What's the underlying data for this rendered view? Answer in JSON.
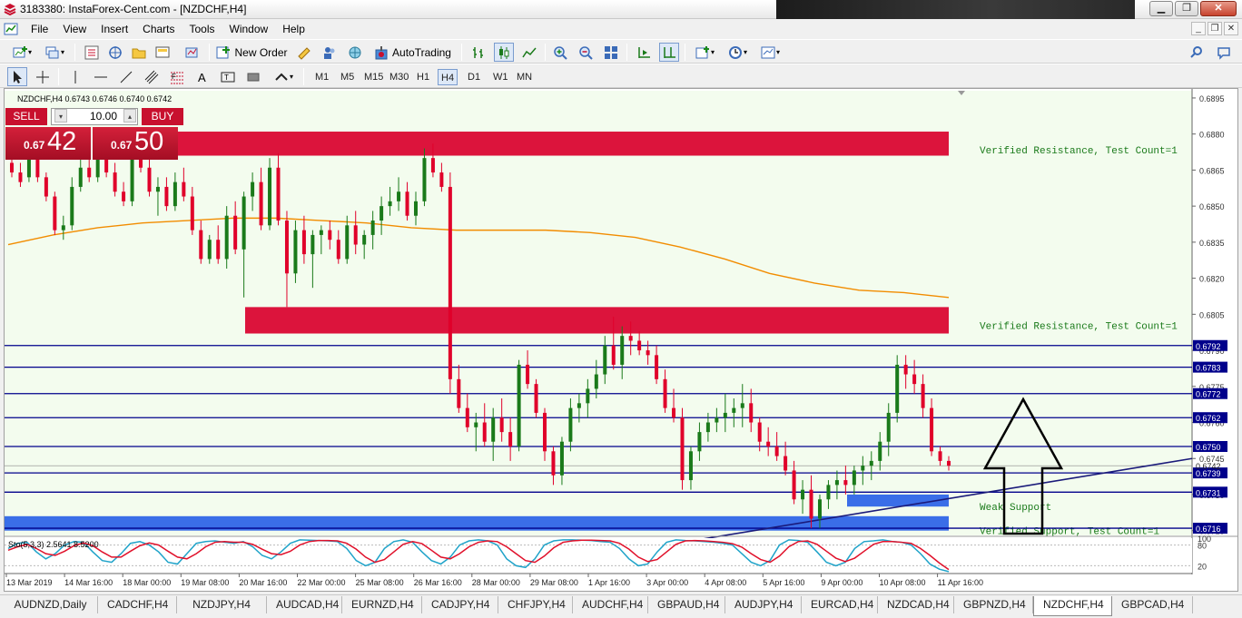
{
  "window": {
    "title": "3183380: InstaForex-Cent.com - [NZDCHF,H4]",
    "min": "▁",
    "max": "❐",
    "close": "✕"
  },
  "menu": [
    "File",
    "View",
    "Insert",
    "Charts",
    "Tools",
    "Window",
    "Help"
  ],
  "mdi": [
    "_",
    "❐",
    "✕"
  ],
  "toolbar": {
    "new_order": "New Order",
    "autotrading": "AutoTrading"
  },
  "timeframes": [
    "M1",
    "M5",
    "M15",
    "M30",
    "H1",
    "H4",
    "D1",
    "W1",
    "MN"
  ],
  "active_timeframe": "H4",
  "trade_panel": {
    "sell_label": "SELL",
    "buy_label": "BUY",
    "lot": "10.00",
    "sell_small": "0.67",
    "sell_big": "42",
    "buy_small": "0.67",
    "buy_big": "50"
  },
  "colors": {
    "bull": "#1a7a1a",
    "bear": "#e0002a",
    "ma": "#f28c00",
    "zone_red": "#dc143c",
    "zone_blue": "#3a6ee8",
    "line_blue": "#00008b",
    "stoch_main": "#1fa3c9",
    "stoch_signal": "#e0102a"
  },
  "chart_data": {
    "type": "candlestick",
    "header": "NZDCHF,H4  0.6743 0.6746 0.6740 0.6742",
    "ylim": [
      0.6713,
      0.6898
    ],
    "y_ticks": [
      "0.6895",
      "0.6880",
      "0.6865",
      "0.6850",
      "0.6835",
      "0.6820",
      "0.6805",
      "0.6790",
      "0.6775",
      "0.6760",
      "0.6745",
      "0.6730",
      "0.6715"
    ],
    "x_ticks": [
      "13 Mar 2019",
      "14 Mar 16:00",
      "18 Mar 00:00",
      "19 Mar 08:00",
      "20 Mar 16:00",
      "22 Mar 00:00",
      "25 Mar 08:00",
      "26 Mar 16:00",
      "28 Mar 00:00",
      "29 Mar 08:00",
      "1 Apr 16:00",
      "3 Apr 00:00",
      "4 Apr 08:00",
      "5 Apr 16:00",
      "9 Apr 00:00",
      "10 Apr 08:00",
      "11 Apr 16:00"
    ],
    "horizontal_levels": [
      {
        "value": 0.6792,
        "label": "0.6792"
      },
      {
        "value": 0.6783,
        "label": "0.6783"
      },
      {
        "value": 0.6772,
        "label": "0.6772"
      },
      {
        "value": 0.6762,
        "label": "0.6762"
      },
      {
        "value": 0.675,
        "label": "0.6750"
      },
      {
        "value": 0.6739,
        "label": "0.6739"
      },
      {
        "value": 0.6731,
        "label": "0.6731"
      },
      {
        "value": 0.6716,
        "label": "0.6716"
      }
    ],
    "current_price": {
      "value": 0.6742,
      "label": "0.6742"
    },
    "zones": [
      {
        "kind": "resistance",
        "y_top": 0.6881,
        "y_bottom": 0.6871,
        "label": "Verified Resistance, Test Count=1"
      },
      {
        "kind": "resistance",
        "y_top": 0.6808,
        "y_bottom": 0.6797,
        "label": "Verified Resistance, Test Count=1"
      },
      {
        "kind": "support",
        "y_top": 0.673,
        "y_bottom": 0.6725,
        "label": "Weak Support"
      },
      {
        "kind": "support",
        "y_top": 0.6721,
        "y_bottom": 0.6715,
        "label": "Verified Support, Test Count=1"
      }
    ],
    "ma_series": [
      0.6834,
      0.6838,
      0.6841,
      0.6843,
      0.6844,
      0.6845,
      0.6845,
      0.6844,
      0.6843,
      0.6841,
      0.684,
      0.684,
      0.684,
      0.6839,
      0.6837,
      0.6833,
      0.6828,
      0.6822,
      0.6818,
      0.6815,
      0.6814,
      0.6812
    ],
    "candles": [
      [
        0.6868,
        0.6872,
        0.6862,
        0.6864
      ],
      [
        0.6864,
        0.6868,
        0.6858,
        0.686
      ],
      [
        0.6862,
        0.6876,
        0.686,
        0.6872
      ],
      [
        0.6872,
        0.6875,
        0.686,
        0.6862
      ],
      [
        0.6862,
        0.6864,
        0.6852,
        0.6854
      ],
      [
        0.6854,
        0.6856,
        0.6838,
        0.684
      ],
      [
        0.684,
        0.6846,
        0.6836,
        0.6842
      ],
      [
        0.6842,
        0.6862,
        0.684,
        0.6858
      ],
      [
        0.6858,
        0.687,
        0.6856,
        0.6866
      ],
      [
        0.6866,
        0.687,
        0.686,
        0.6862
      ],
      [
        0.6862,
        0.6874,
        0.686,
        0.687
      ],
      [
        0.687,
        0.6872,
        0.6862,
        0.6864
      ],
      [
        0.6864,
        0.6868,
        0.6854,
        0.6856
      ],
      [
        0.6856,
        0.686,
        0.685,
        0.6852
      ],
      [
        0.6852,
        0.6876,
        0.685,
        0.6872
      ],
      [
        0.6872,
        0.6876,
        0.6864,
        0.6866
      ],
      [
        0.6866,
        0.687,
        0.6854,
        0.6856
      ],
      [
        0.6856,
        0.6862,
        0.6846,
        0.6858
      ],
      [
        0.6858,
        0.6862,
        0.6848,
        0.685
      ],
      [
        0.685,
        0.6864,
        0.6848,
        0.686
      ],
      [
        0.686,
        0.6866,
        0.6852,
        0.6854
      ],
      [
        0.6854,
        0.6858,
        0.6838,
        0.684
      ],
      [
        0.684,
        0.6844,
        0.6826,
        0.6828
      ],
      [
        0.6828,
        0.6838,
        0.6826,
        0.6836
      ],
      [
        0.6836,
        0.6842,
        0.6826,
        0.6828
      ],
      [
        0.6828,
        0.685,
        0.6824,
        0.6846
      ],
      [
        0.6846,
        0.6852,
        0.683,
        0.6832
      ],
      [
        0.6832,
        0.6856,
        0.6812,
        0.6854
      ],
      [
        0.6854,
        0.6864,
        0.6848,
        0.686
      ],
      [
        0.686,
        0.6866,
        0.684,
        0.6842
      ],
      [
        0.6842,
        0.687,
        0.684,
        0.6866
      ],
      [
        0.6866,
        0.6872,
        0.6842,
        0.6844
      ],
      [
        0.6844,
        0.6848,
        0.6808,
        0.6822
      ],
      [
        0.6822,
        0.6844,
        0.6818,
        0.684
      ],
      [
        0.684,
        0.6846,
        0.6826,
        0.683
      ],
      [
        0.683,
        0.684,
        0.6816,
        0.6838
      ],
      [
        0.6838,
        0.6842,
        0.683,
        0.684
      ],
      [
        0.684,
        0.6844,
        0.6832,
        0.6836
      ],
      [
        0.6836,
        0.684,
        0.6826,
        0.6828
      ],
      [
        0.6828,
        0.6846,
        0.6826,
        0.6842
      ],
      [
        0.6842,
        0.6848,
        0.683,
        0.6834
      ],
      [
        0.6834,
        0.684,
        0.6828,
        0.6838
      ],
      [
        0.6838,
        0.6848,
        0.6832,
        0.6844
      ],
      [
        0.6844,
        0.6854,
        0.6838,
        0.685
      ],
      [
        0.685,
        0.6858,
        0.6846,
        0.6852
      ],
      [
        0.6852,
        0.6862,
        0.6848,
        0.6856
      ],
      [
        0.6856,
        0.686,
        0.6844,
        0.6846
      ],
      [
        0.6846,
        0.6856,
        0.6842,
        0.6852
      ],
      [
        0.6852,
        0.6874,
        0.685,
        0.687
      ],
      [
        0.687,
        0.6876,
        0.6862,
        0.6864
      ],
      [
        0.6864,
        0.6868,
        0.6856,
        0.6858
      ],
      [
        0.6858,
        0.6864,
        0.6772,
        0.6778
      ],
      [
        0.6778,
        0.6784,
        0.6764,
        0.6766
      ],
      [
        0.6766,
        0.6772,
        0.6756,
        0.6758
      ],
      [
        0.6758,
        0.6764,
        0.6748,
        0.676
      ],
      [
        0.676,
        0.6768,
        0.675,
        0.6752
      ],
      [
        0.6752,
        0.6766,
        0.6744,
        0.6762
      ],
      [
        0.6762,
        0.677,
        0.6752,
        0.6756
      ],
      [
        0.6756,
        0.6762,
        0.6744,
        0.675
      ],
      [
        0.675,
        0.6786,
        0.6748,
        0.6784
      ],
      [
        0.6784,
        0.679,
        0.6774,
        0.6776
      ],
      [
        0.6776,
        0.6778,
        0.6762,
        0.6764
      ],
      [
        0.6764,
        0.6766,
        0.6744,
        0.6748
      ],
      [
        0.6748,
        0.675,
        0.6734,
        0.6738
      ],
      [
        0.6738,
        0.6754,
        0.6734,
        0.6752
      ],
      [
        0.6752,
        0.677,
        0.6748,
        0.6766
      ],
      [
        0.6766,
        0.6772,
        0.676,
        0.6768
      ],
      [
        0.6768,
        0.6778,
        0.6762,
        0.6774
      ],
      [
        0.6774,
        0.6786,
        0.677,
        0.678
      ],
      [
        0.678,
        0.6796,
        0.6776,
        0.6792
      ],
      [
        0.6792,
        0.6804,
        0.6782,
        0.6784
      ],
      [
        0.6784,
        0.68,
        0.6778,
        0.6796
      ],
      [
        0.6796,
        0.6802,
        0.6788,
        0.6794
      ],
      [
        0.6794,
        0.6798,
        0.6788,
        0.679
      ],
      [
        0.679,
        0.6794,
        0.6784,
        0.6788
      ],
      [
        0.6788,
        0.6792,
        0.6776,
        0.6778
      ],
      [
        0.6778,
        0.6782,
        0.6764,
        0.6766
      ],
      [
        0.6766,
        0.6774,
        0.676,
        0.6762
      ],
      [
        0.6762,
        0.6766,
        0.6732,
        0.6736
      ],
      [
        0.6736,
        0.675,
        0.6732,
        0.6748
      ],
      [
        0.6748,
        0.676,
        0.6744,
        0.6756
      ],
      [
        0.6756,
        0.6764,
        0.6752,
        0.676
      ],
      [
        0.676,
        0.6766,
        0.6756,
        0.6762
      ],
      [
        0.6762,
        0.6772,
        0.6756,
        0.6764
      ],
      [
        0.6764,
        0.677,
        0.6758,
        0.6766
      ],
      [
        0.6766,
        0.6776,
        0.6758,
        0.6768
      ],
      [
        0.6768,
        0.6774,
        0.6756,
        0.676
      ],
      [
        0.676,
        0.6762,
        0.6748,
        0.6752
      ],
      [
        0.6752,
        0.6758,
        0.6746,
        0.675
      ],
      [
        0.675,
        0.6756,
        0.6744,
        0.6746
      ],
      [
        0.6746,
        0.6752,
        0.6738,
        0.674
      ],
      [
        0.674,
        0.6744,
        0.6726,
        0.6728
      ],
      [
        0.6728,
        0.6736,
        0.6722,
        0.6732
      ],
      [
        0.6732,
        0.6738,
        0.6716,
        0.672
      ],
      [
        0.672,
        0.673,
        0.6716,
        0.6728
      ],
      [
        0.6728,
        0.6736,
        0.6724,
        0.6734
      ],
      [
        0.6734,
        0.674,
        0.6728,
        0.6736
      ],
      [
        0.6736,
        0.6742,
        0.673,
        0.6734
      ],
      [
        0.6734,
        0.6742,
        0.673,
        0.674
      ],
      [
        0.674,
        0.6746,
        0.6734,
        0.6742
      ],
      [
        0.6742,
        0.6748,
        0.6736,
        0.6744
      ],
      [
        0.6744,
        0.6756,
        0.674,
        0.6752
      ],
      [
        0.6752,
        0.6768,
        0.6746,
        0.6764
      ],
      [
        0.6764,
        0.6788,
        0.676,
        0.6784
      ],
      [
        0.6784,
        0.6788,
        0.6774,
        0.678
      ],
      [
        0.678,
        0.6786,
        0.6772,
        0.6776
      ],
      [
        0.6776,
        0.678,
        0.6762,
        0.6766
      ],
      [
        0.6766,
        0.677,
        0.6746,
        0.6748
      ],
      [
        0.6748,
        0.675,
        0.6742,
        0.6744
      ],
      [
        0.6744,
        0.6746,
        0.674,
        0.6742
      ]
    ],
    "stochastic": {
      "label": "Sto(5,3,3) 2.5641 8.5200",
      "ylim": [
        0,
        100
      ],
      "y_ticks": [
        "100",
        "80",
        "20"
      ],
      "main": [
        70,
        85,
        88,
        60,
        40,
        55,
        80,
        90,
        88,
        60,
        35,
        30,
        55,
        85,
        90,
        80,
        60,
        30,
        25,
        55,
        85,
        90,
        92,
        88,
        85,
        90,
        75,
        50,
        40,
        60,
        85,
        95,
        94,
        93,
        92,
        90,
        70,
        35,
        20,
        30,
        70,
        90,
        95,
        88,
        60,
        35,
        25,
        45,
        80,
        92,
        95,
        92,
        80,
        40,
        20,
        15,
        40,
        80,
        92,
        95,
        95,
        94,
        93,
        90,
        88,
        70,
        40,
        20,
        25,
        60,
        88,
        95,
        93,
        92,
        90,
        88,
        85,
        80,
        55,
        30,
        20,
        35,
        80,
        95,
        93,
        88,
        60,
        30,
        20,
        30,
        70,
        90,
        92,
        95,
        90,
        88,
        80,
        55,
        25,
        10,
        3
      ],
      "signal": [
        65,
        75,
        82,
        70,
        55,
        50,
        62,
        78,
        86,
        78,
        60,
        45,
        45,
        62,
        78,
        86,
        80,
        62,
        45,
        40,
        55,
        75,
        88,
        90,
        88,
        88,
        82,
        68,
        55,
        52,
        62,
        80,
        90,
        93,
        93,
        92,
        85,
        68,
        45,
        30,
        38,
        60,
        82,
        90,
        84,
        65,
        45,
        40,
        55,
        75,
        88,
        92,
        90,
        75,
        55,
        35,
        30,
        48,
        72,
        88,
        92,
        94,
        94,
        93,
        92,
        85,
        68,
        45,
        32,
        38,
        60,
        82,
        92,
        93,
        92,
        90,
        88,
        84,
        74,
        55,
        38,
        30,
        48,
        75,
        90,
        92,
        82,
        62,
        42,
        32,
        42,
        62,
        82,
        90,
        90,
        88,
        85,
        70,
        50,
        28,
        9
      ]
    }
  },
  "tabs": [
    "AUDNZD,Daily",
    "CADCHF,H4",
    "NZDJPY,H4",
    "AUDCAD,H4",
    "EURNZD,H4",
    "CADJPY,H4",
    "CHFJPY,H4",
    "AUDCHF,H4",
    "GBPAUD,H4",
    "AUDJPY,H4",
    "EURCAD,H4",
    "NZDCAD,H4",
    "GBPNZD,H4",
    "NZDCHF,H4",
    "GBPCAD,H4"
  ],
  "active_tab": "NZDCHF,H4"
}
